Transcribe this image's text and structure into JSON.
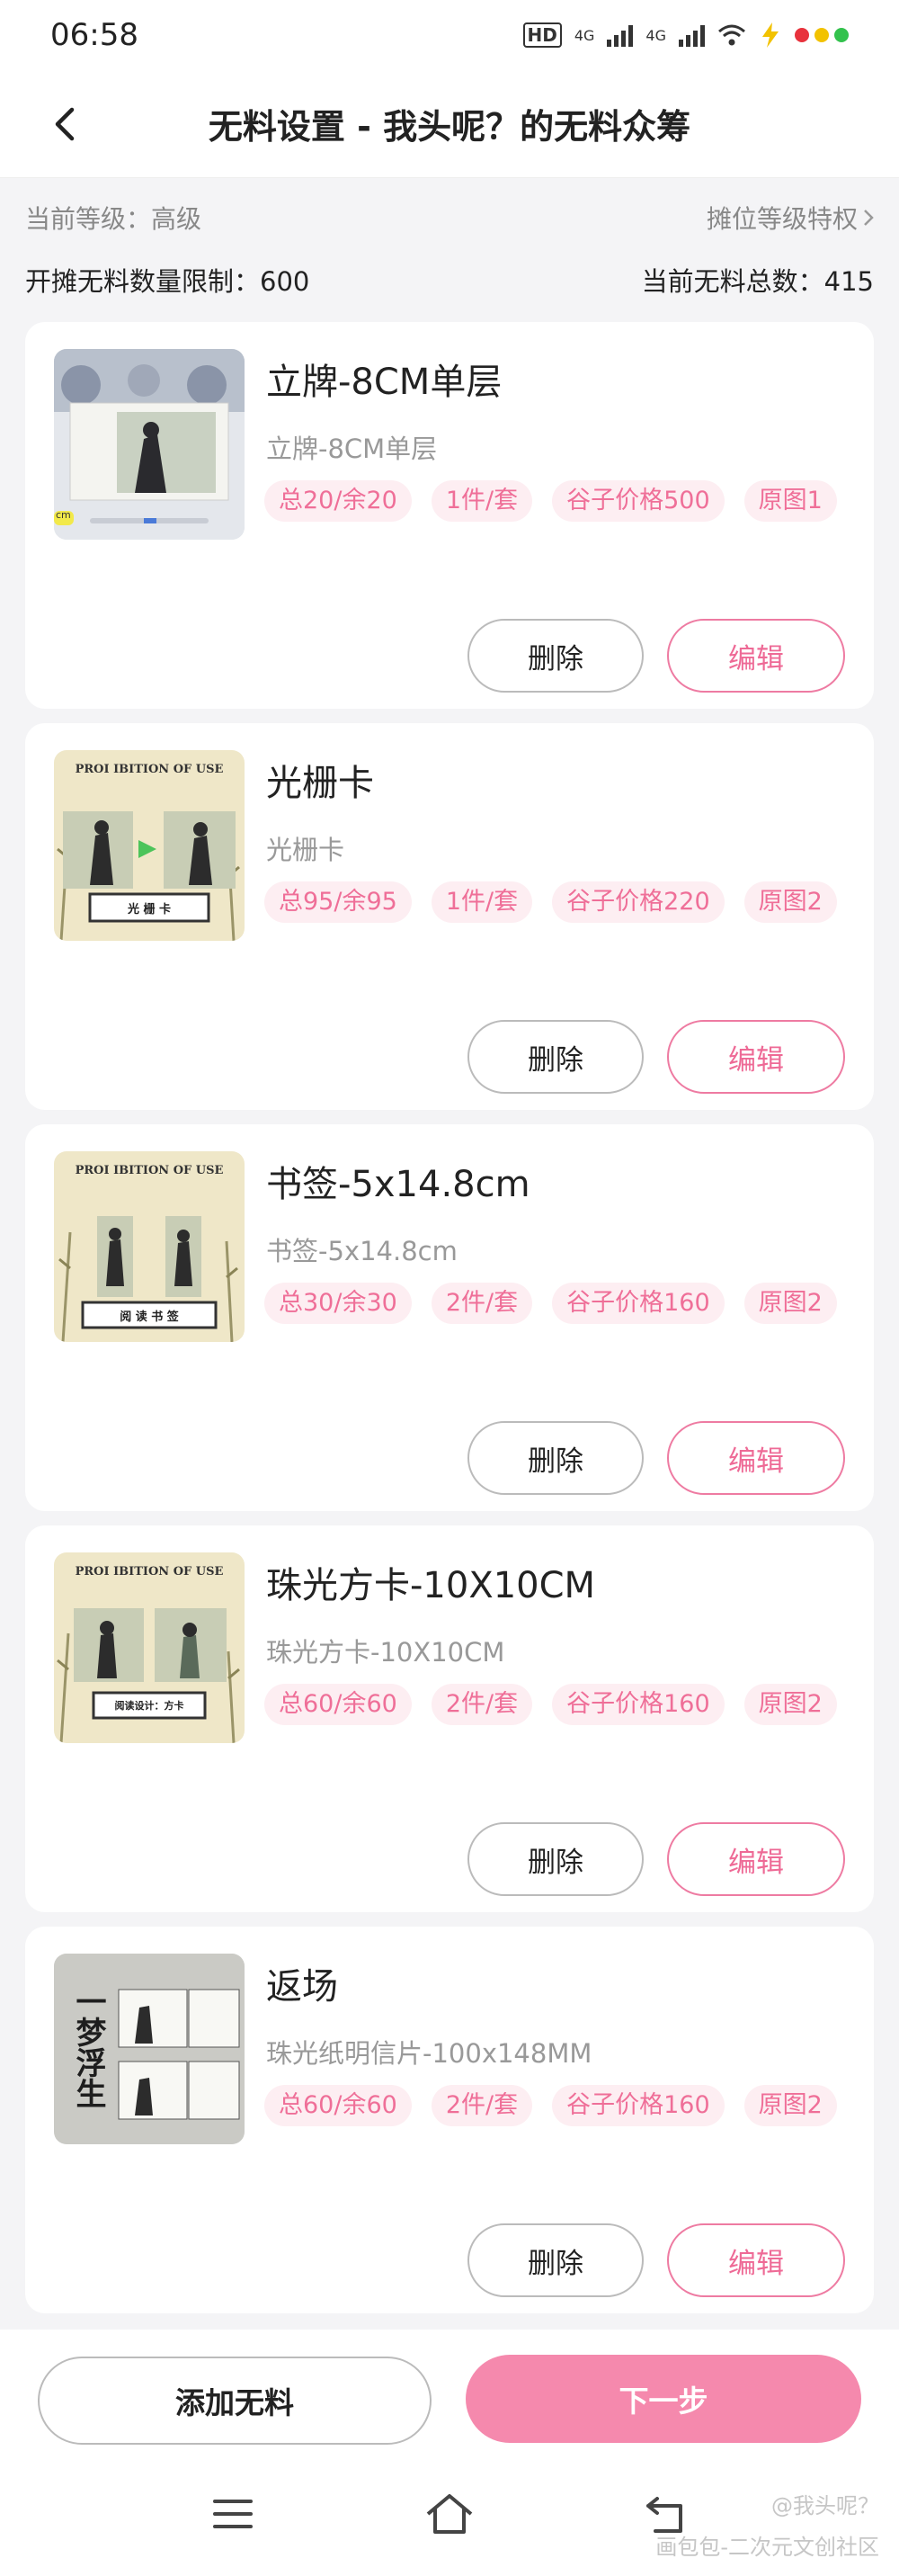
{
  "status": {
    "time": "06:58",
    "network_1": "4G",
    "network_2": "4G",
    "hd_label": "HD"
  },
  "header": {
    "title": "无料设置 - 我头呢？的无料众筹"
  },
  "summary": {
    "level_label": "当前等级：高级",
    "privilege_link": "摊位等级特权",
    "limit_label": "开摊无料数量限制：600",
    "total_label": "当前无料总数：415"
  },
  "items": [
    {
      "title": "立牌-8CM单层",
      "subtitle": "立牌-8CM单层",
      "tags": [
        "总20/余20",
        "1件/套",
        "谷子价格500",
        "原图1"
      ],
      "thumb_label": "cm"
    },
    {
      "title": "光栅卡",
      "subtitle": "光栅卡",
      "tags": [
        "总95/余95",
        "1件/套",
        "谷子价格220",
        "原图2"
      ],
      "thumb_label": "光 栅 卡"
    },
    {
      "title": "书签-5x14.8cm",
      "subtitle": "书签-5x14.8cm",
      "tags": [
        "总30/余30",
        "2件/套",
        "谷子价格160",
        "原图2"
      ],
      "thumb_label": "阅 读 书 签"
    },
    {
      "title": "珠光方卡-10X10CM",
      "subtitle": "珠光方卡-10X10CM",
      "tags": [
        "总60/余60",
        "2件/套",
        "谷子价格160",
        "原图2"
      ],
      "thumb_label": "阅读设计：方卡"
    },
    {
      "title": "返场",
      "subtitle": "珠光纸明信片-100x148MM",
      "tags": [
        "总60/余60",
        "2件/套",
        "谷子价格160",
        "原图2"
      ],
      "thumb_label": "一梦浮生"
    }
  ],
  "thumb_banner": "PROI IBITION OF USE",
  "card_actions": {
    "delete_label": "删除",
    "edit_label": "编辑"
  },
  "footer": {
    "add_label": "添加无料",
    "next_label": "下一步"
  },
  "watermarks": {
    "line1": "@我头呢？",
    "line2": "画包包-二次元文创社区"
  },
  "colors": {
    "accent": "#f589ad",
    "tag_bg": "#fdeef2",
    "tag_text": "#ef6f98"
  }
}
